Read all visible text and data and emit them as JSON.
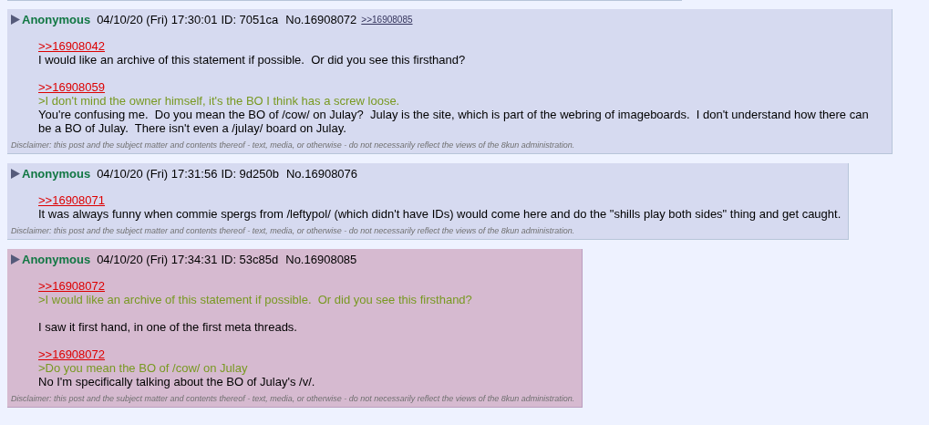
{
  "posts": [
    {
      "name": "Anonymous",
      "date": "04/10/20 (Fri) 17:30:01",
      "id": "ID: 7051ca",
      "number": "No.16908072",
      "backlinks": [
        ">>16908085"
      ],
      "highlighted": false,
      "blocks": [
        [
          {
            "kind": "link",
            "text": ">>16908042"
          },
          {
            "kind": "text",
            "text": "I would like an archive of this statement if possible.  Or did you see this firsthand?"
          }
        ],
        [
          {
            "kind": "link",
            "text": ">>16908059"
          },
          {
            "kind": "green",
            "text": ">I don't mind the owner himself, it's the BO I think has a screw loose."
          },
          {
            "kind": "text",
            "text": "You're confusing me.  Do you mean the BO of /cow/ on Julay?  Julay is the site, which is part of the webring of imageboards.  I don't understand how there can be a BO of Julay.  There isn't even a /julay/ board on Julay."
          }
        ]
      ],
      "disclaimer": "Disclaimer: this post and the subject matter and contents thereof - text, media, or otherwise - do not necessarily reflect the views of the 8kun administration."
    },
    {
      "name": "Anonymous",
      "date": "04/10/20 (Fri) 17:31:56",
      "id": "ID: 9d250b",
      "number": "No.16908076",
      "highlighted": false,
      "blocks": [
        [
          {
            "kind": "link",
            "text": ">>16908071"
          },
          {
            "kind": "text",
            "text": "It was always funny when commie spergs from /leftypol/ (which didn't have IDs) would come here and do the \"shills play both sides\" thing and get caught."
          }
        ]
      ],
      "disclaimer": "Disclaimer: this post and the subject matter and contents thereof - text, media, or otherwise - do not necessarily reflect the views of the 8kun administration."
    },
    {
      "name": "Anonymous",
      "date": "04/10/20 (Fri) 17:34:31",
      "id": "ID: 53c85d",
      "number": "No.16908085",
      "highlighted": true,
      "blocks": [
        [
          {
            "kind": "link",
            "text": ">>16908072"
          },
          {
            "kind": "green",
            "text": ">I would like an archive of this statement if possible.  Or did you see this firsthand?"
          }
        ],
        [
          {
            "kind": "text",
            "text": "I saw it first hand, in one of the first meta threads."
          }
        ],
        [
          {
            "kind": "link",
            "text": ">>16908072"
          },
          {
            "kind": "green",
            "text": ">Do you mean the BO of /cow/ on Julay"
          },
          {
            "kind": "text",
            "text": "No I'm specifically talking about the BO of Julay's /v/."
          }
        ]
      ],
      "disclaimer": "Disclaimer: this post and the subject matter and contents thereof - text, media, or otherwise - do not necessarily reflect the views of the 8kun administration."
    }
  ]
}
